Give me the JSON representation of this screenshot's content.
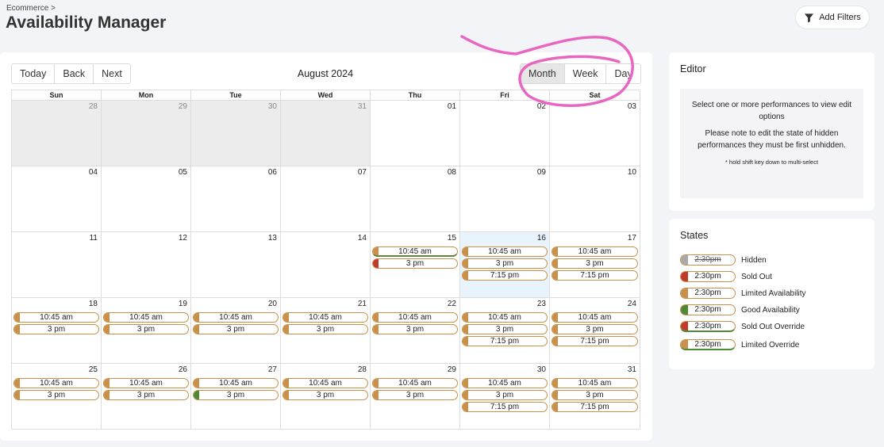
{
  "header": {
    "breadcrumb": "Ecommerce  >",
    "title": "Availability Manager",
    "filters_label": "Add Filters"
  },
  "toolbar": {
    "today": "Today",
    "back": "Back",
    "next": "Next",
    "month_label": "August 2024",
    "views": {
      "month": "Month",
      "week": "Week",
      "day": "Day"
    },
    "active_view": "Month"
  },
  "weekdays": [
    "Sun",
    "Mon",
    "Tue",
    "Wed",
    "Thu",
    "Fri",
    "Sat"
  ],
  "colors": {
    "limited": "#c8904a",
    "sold_out": "#c0392b",
    "good": "#4e8a35",
    "hidden": "#a9a9a9",
    "today_bg": "#e8f3fc",
    "annotation": "#e866c2"
  },
  "weeks": [
    [
      {
        "d": "28",
        "off": true
      },
      {
        "d": "29",
        "off": true
      },
      {
        "d": "30",
        "off": true
      },
      {
        "d": "31",
        "off": true
      },
      {
        "d": "01"
      },
      {
        "d": "02"
      },
      {
        "d": "03"
      }
    ],
    [
      {
        "d": "04"
      },
      {
        "d": "05"
      },
      {
        "d": "06"
      },
      {
        "d": "07"
      },
      {
        "d": "08"
      },
      {
        "d": "09"
      },
      {
        "d": "10"
      }
    ],
    [
      {
        "d": "11"
      },
      {
        "d": "12"
      },
      {
        "d": "13"
      },
      {
        "d": "14"
      },
      {
        "d": "15",
        "ev": [
          {
            "t": "10:45 am",
            "s": "limited",
            "ul": true
          },
          {
            "t": "3 pm",
            "s": "sold_out"
          }
        ]
      },
      {
        "d": "16",
        "today": true,
        "ev": [
          {
            "t": "10:45 am",
            "s": "limited"
          },
          {
            "t": "3 pm",
            "s": "limited"
          },
          {
            "t": "7:15 pm",
            "s": "limited"
          }
        ]
      },
      {
        "d": "17",
        "ev": [
          {
            "t": "10:45 am",
            "s": "limited"
          },
          {
            "t": "3 pm",
            "s": "limited"
          },
          {
            "t": "7:15 pm",
            "s": "limited"
          }
        ]
      }
    ],
    [
      {
        "d": "18",
        "ev": [
          {
            "t": "10:45 am",
            "s": "limited"
          },
          {
            "t": "3 pm",
            "s": "limited"
          }
        ]
      },
      {
        "d": "19",
        "ev": [
          {
            "t": "10:45 am",
            "s": "limited"
          },
          {
            "t": "3 pm",
            "s": "limited"
          }
        ]
      },
      {
        "d": "20",
        "ev": [
          {
            "t": "10:45 am",
            "s": "limited"
          },
          {
            "t": "3 pm",
            "s": "limited"
          }
        ]
      },
      {
        "d": "21",
        "ev": [
          {
            "t": "10:45 am",
            "s": "limited"
          },
          {
            "t": "3 pm",
            "s": "limited"
          }
        ]
      },
      {
        "d": "22",
        "ev": [
          {
            "t": "10:45 am",
            "s": "limited"
          },
          {
            "t": "3 pm",
            "s": "limited"
          }
        ]
      },
      {
        "d": "23",
        "ev": [
          {
            "t": "10:45 am",
            "s": "limited"
          },
          {
            "t": "3 pm",
            "s": "limited"
          },
          {
            "t": "7:15 pm",
            "s": "limited"
          }
        ]
      },
      {
        "d": "24",
        "ev": [
          {
            "t": "10:45 am",
            "s": "limited"
          },
          {
            "t": "3 pm",
            "s": "limited"
          },
          {
            "t": "7:15 pm",
            "s": "limited"
          }
        ]
      }
    ],
    [
      {
        "d": "25",
        "ev": [
          {
            "t": "10:45 am",
            "s": "limited"
          },
          {
            "t": "3 pm",
            "s": "limited"
          }
        ]
      },
      {
        "d": "26",
        "ev": [
          {
            "t": "10:45 am",
            "s": "limited"
          },
          {
            "t": "3 pm",
            "s": "limited"
          }
        ]
      },
      {
        "d": "27",
        "ev": [
          {
            "t": "10:45 am",
            "s": "limited"
          },
          {
            "t": "3 pm",
            "s": "good"
          }
        ]
      },
      {
        "d": "28",
        "ev": [
          {
            "t": "10:45 am",
            "s": "limited"
          },
          {
            "t": "3 pm",
            "s": "limited"
          }
        ]
      },
      {
        "d": "29",
        "ev": [
          {
            "t": "10:45 am",
            "s": "limited"
          },
          {
            "t": "3 pm",
            "s": "limited"
          }
        ]
      },
      {
        "d": "30",
        "ev": [
          {
            "t": "10:45 am",
            "s": "limited"
          },
          {
            "t": "3 pm",
            "s": "limited"
          },
          {
            "t": "7:15 pm",
            "s": "limited"
          }
        ]
      },
      {
        "d": "31",
        "ev": [
          {
            "t": "10:45 am",
            "s": "limited"
          },
          {
            "t": "3 pm",
            "s": "limited"
          },
          {
            "t": "7:15 pm",
            "s": "limited"
          }
        ]
      }
    ]
  ],
  "editor": {
    "title": "Editor",
    "line1": "Select one or more performances to view edit options",
    "line2": "Please note to edit the state of hidden performances they must be first unhidden.",
    "hint": "* hold shift key down to multi-select"
  },
  "states": {
    "title": "States",
    "items": [
      {
        "pill": "2:30pm",
        "label": "Hidden",
        "s": "hidden",
        "strike": true
      },
      {
        "pill": "2:30pm",
        "label": "Sold Out",
        "s": "sold_out"
      },
      {
        "pill": "2:30pm",
        "label": "Limited Availability",
        "s": "limited"
      },
      {
        "pill": "2:30pm",
        "label": "Good Availability",
        "s": "good"
      },
      {
        "pill": "2:30pm",
        "label": "Sold Out Override",
        "s": "sold_out",
        "ul": true
      },
      {
        "pill": "2:30pm",
        "label": "Limited Override",
        "s": "limited",
        "ul": true
      }
    ]
  }
}
